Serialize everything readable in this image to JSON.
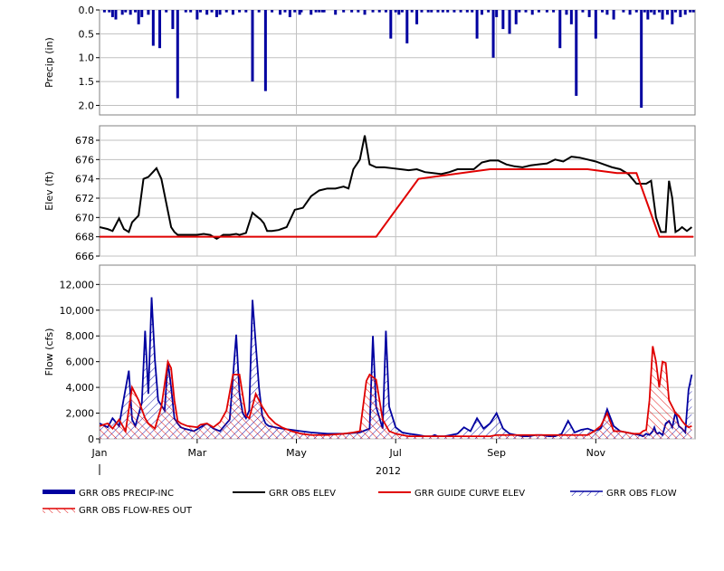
{
  "chart_data": [
    {
      "type": "bar",
      "panel": "precip",
      "ylabel": "Precip (in)",
      "ylim": [
        2.2,
        0.0
      ],
      "y_inverted": true,
      "yticks": [
        0.0,
        0.5,
        1.0,
        1.5,
        2.0
      ],
      "ytick_labels": [
        "0.0",
        "0.5",
        "1.0",
        "1.5",
        "2.0"
      ],
      "grid": true,
      "series": [
        {
          "name": "GRR OBS PRECIP-INC",
          "color": "#0000a0",
          "x": [
            3,
            6,
            8,
            10,
            14,
            16,
            19,
            22,
            24,
            26,
            30,
            33,
            37,
            41,
            45,
            48,
            53,
            56,
            60,
            62,
            66,
            69,
            72,
            74,
            78,
            82,
            86,
            90,
            94,
            98,
            102,
            106,
            111,
            114,
            117,
            120,
            123,
            124,
            130,
            133,
            135,
            137,
            138,
            145,
            150,
            155,
            159,
            163,
            168,
            172,
            176,
            179,
            182,
            184,
            186,
            189,
            192,
            195,
            198,
            202,
            204,
            208,
            211,
            214,
            218,
            222,
            226,
            229,
            232,
            235,
            239,
            242,
            244,
            248,
            252,
            256,
            258,
            262,
            266,
            270,
            275,
            279,
            283,
            287,
            290,
            293,
            297,
            301,
            305,
            309,
            312,
            316,
            322,
            326,
            330,
            333,
            335,
            337,
            339,
            341,
            344,
            346,
            349,
            352,
            354,
            357,
            360,
            363,
            365
          ],
          "values": [
            0.05,
            0.05,
            0.15,
            0.2,
            0.1,
            0.05,
            0.1,
            0.05,
            0.3,
            0.15,
            0.1,
            0.75,
            0.8,
            0.05,
            0.4,
            1.85,
            0.05,
            0.05,
            0.2,
            0.05,
            0.1,
            0.05,
            0.15,
            0.1,
            0.05,
            0.1,
            0.05,
            0.05,
            1.5,
            0.05,
            1.7,
            0.05,
            0.1,
            0.05,
            0.15,
            0.05,
            0.1,
            0.05,
            0.1,
            0.05,
            0.05,
            0.05,
            0.05,
            0.1,
            0.05,
            0.05,
            0.05,
            0.1,
            0.05,
            0.05,
            0.05,
            0.6,
            0.05,
            0.1,
            0.05,
            0.7,
            0.05,
            0.3,
            0.05,
            0.05,
            0.05,
            0.05,
            0.05,
            0.05,
            0.05,
            0.05,
            0.05,
            0.05,
            0.6,
            0.1,
            0.05,
            1.0,
            0.15,
            0.4,
            0.5,
            0.3,
            0.05,
            0.05,
            0.1,
            0.05,
            0.05,
            0.05,
            0.8,
            0.1,
            0.3,
            1.8,
            0.05,
            0.15,
            0.6,
            0.05,
            0.1,
            0.2,
            0.05,
            0.1,
            0.05,
            2.05,
            0.05,
            0.2,
            0.05,
            0.1,
            0.05,
            0.2,
            0.1,
            0.3,
            0.05,
            0.15,
            0.1,
            0.05,
            0.05
          ]
        }
      ]
    },
    {
      "type": "line",
      "panel": "elev",
      "ylabel": "Elev (ft)",
      "ylim": [
        666,
        679.5
      ],
      "yticks": [
        666,
        668,
        670,
        672,
        674,
        676,
        678
      ],
      "ytick_labels": [
        "666",
        "668",
        "670",
        "672",
        "674",
        "676",
        "678"
      ],
      "grid": true,
      "series": [
        {
          "name": "GRR OBS ELEV",
          "color": "#000000",
          "x": [
            0,
            5,
            8,
            12,
            15,
            18,
            20,
            24,
            27,
            30,
            35,
            38,
            41,
            44,
            46,
            48,
            50,
            53,
            56,
            60,
            64,
            68,
            72,
            76,
            80,
            84,
            86,
            90,
            94,
            96,
            99,
            101,
            103,
            106,
            110,
            115,
            120,
            125,
            130,
            135,
            140,
            145,
            150,
            153,
            156,
            160,
            163,
            166,
            170,
            175,
            180,
            185,
            190,
            195,
            200,
            205,
            210,
            215,
            220,
            225,
            230,
            235,
            240,
            245,
            250,
            255,
            260,
            265,
            270,
            275,
            280,
            285,
            290,
            295,
            300,
            305,
            310,
            315,
            320,
            325,
            330,
            334,
            336,
            339,
            342,
            345,
            348,
            350,
            352,
            354,
            356,
            358,
            361,
            364
          ],
          "values": [
            669.0,
            668.8,
            668.6,
            669.9,
            668.8,
            668.5,
            669.5,
            670.2,
            674.0,
            674.2,
            675.1,
            674.0,
            671.5,
            669.0,
            668.5,
            668.2,
            668.2,
            668.2,
            668.2,
            668.2,
            668.3,
            668.2,
            667.8,
            668.2,
            668.2,
            668.3,
            668.2,
            668.4,
            670.5,
            670.2,
            669.8,
            669.4,
            668.6,
            668.6,
            668.7,
            669.0,
            670.8,
            671.0,
            672.2,
            672.8,
            673.0,
            673.0,
            673.2,
            673.0,
            675.0,
            676.0,
            678.5,
            675.5,
            675.2,
            675.2,
            675.1,
            675.0,
            674.9,
            675.0,
            674.7,
            674.6,
            674.5,
            674.7,
            675.0,
            675.0,
            675.0,
            675.7,
            675.9,
            675.9,
            675.5,
            675.3,
            675.2,
            675.4,
            675.5,
            675.6,
            676.0,
            675.8,
            676.3,
            676.2,
            676.0,
            675.8,
            675.5,
            675.2,
            675.0,
            674.5,
            673.5,
            673.5,
            673.5,
            673.8,
            670.0,
            668.5,
            668.5,
            673.8,
            672.0,
            668.5,
            668.7,
            669.0,
            668.6,
            669.0
          ]
        },
        {
          "name": "GRR GUIDE CURVE ELEV",
          "color": "#e00000",
          "x": [
            0,
            74,
            90,
            110,
            130,
            150,
            170,
            196,
            240,
            280,
            300,
            318,
            330,
            344,
            365
          ],
          "values": [
            668.0,
            668.0,
            668.0,
            668.0,
            668.0,
            668.0,
            668.0,
            674.0,
            675.0,
            675.0,
            675.0,
            674.6,
            674.6,
            668.0,
            668.0
          ]
        }
      ]
    },
    {
      "type": "area",
      "panel": "flow",
      "ylabel": "Flow (cfs)",
      "ylim": [
        0,
        13500
      ],
      "yticks": [
        0,
        2000,
        4000,
        6000,
        8000,
        10000,
        12000
      ],
      "ytick_labels": [
        "0",
        "2,000",
        "4,000",
        "6,000",
        "8,000",
        "10,000",
        "12,000"
      ],
      "xticks": [
        0,
        60,
        121,
        182,
        244,
        305
      ],
      "xtick_labels": [
        "Jan",
        "Mar",
        "May",
        "Jul",
        "Sep",
        "Nov"
      ],
      "xlabel": "2012",
      "grid": true,
      "series": [
        {
          "name": "GRR OBS FLOW",
          "color": "#0000a0",
          "x": [
            0,
            5,
            8,
            12,
            14,
            18,
            20,
            22,
            26,
            28,
            30,
            32,
            34,
            36,
            38,
            40,
            42,
            44,
            46,
            48,
            50,
            52,
            55,
            58,
            62,
            66,
            70,
            74,
            80,
            84,
            86,
            88,
            90,
            92,
            94,
            98,
            100,
            102,
            104,
            108,
            112,
            118,
            124,
            130,
            140,
            150,
            160,
            166,
            168,
            170,
            174,
            176,
            178,
            182,
            186,
            190,
            196,
            200,
            204,
            206,
            208,
            212,
            216,
            220,
            224,
            228,
            232,
            236,
            240,
            244,
            248,
            252,
            256,
            260,
            264,
            268,
            272,
            276,
            280,
            284,
            288,
            292,
            296,
            300,
            304,
            308,
            312,
            316,
            320,
            324,
            328,
            332,
            334,
            336,
            338,
            340,
            341,
            342,
            343,
            344,
            346,
            348,
            350,
            352,
            354,
            356,
            358,
            360,
            362,
            364
          ],
          "values": [
            1200,
            900,
            1600,
            1000,
            2500,
            5300,
            1500,
            1000,
            2800,
            8400,
            3500,
            11000,
            6200,
            3000,
            2600,
            2200,
            6000,
            4000,
            1600,
            1200,
            900,
            800,
            700,
            600,
            900,
            1200,
            800,
            600,
            1500,
            8100,
            3500,
            2000,
            1600,
            2200,
            10800,
            4000,
            1800,
            1200,
            1000,
            900,
            800,
            700,
            600,
            500,
            400,
            400,
            500,
            800,
            8000,
            2500,
            800,
            8400,
            2500,
            900,
            500,
            400,
            300,
            200,
            200,
            300,
            200,
            200,
            300,
            400,
            900,
            600,
            1600,
            800,
            1200,
            2000,
            800,
            400,
            300,
            200,
            200,
            300,
            300,
            200,
            200,
            400,
            1400,
            500,
            700,
            800,
            600,
            800,
            2300,
            1000,
            600,
            500,
            400,
            300,
            200,
            400,
            300,
            600,
            900,
            500,
            400,
            500,
            300,
            1200,
            1400,
            900,
            2100,
            1000,
            800,
            500,
            3800,
            5000
          ]
        },
        {
          "name": "GRR OBS FLOW-RES OUT",
          "color": "#e00000",
          "x": [
            0,
            5,
            8,
            12,
            16,
            20,
            24,
            28,
            30,
            34,
            38,
            42,
            44,
            46,
            48,
            50,
            54,
            60,
            62,
            66,
            70,
            74,
            78,
            82,
            86,
            90,
            92,
            96,
            100,
            104,
            108,
            112,
            118,
            124,
            130,
            140,
            150,
            156,
            160,
            164,
            166,
            170,
            174,
            178,
            182,
            186,
            190,
            196,
            200,
            206,
            212,
            218,
            224,
            230,
            236,
            240,
            244,
            248,
            252,
            256,
            260,
            264,
            268,
            272,
            276,
            280,
            284,
            288,
            292,
            296,
            300,
            304,
            308,
            312,
            316,
            320,
            324,
            328,
            332,
            334,
            336,
            338,
            340,
            342,
            344,
            346,
            348,
            350,
            352,
            354,
            356,
            358,
            360,
            362,
            364
          ],
          "values": [
            1000,
            1200,
            800,
            1500,
            600,
            4000,
            3000,
            1600,
            1200,
            800,
            2500,
            6000,
            5500,
            3000,
            1400,
            1200,
            1000,
            900,
            1100,
            1200,
            900,
            1300,
            2200,
            5000,
            5000,
            1800,
            1600,
            3500,
            2500,
            1700,
            1200,
            900,
            600,
            400,
            300,
            300,
            400,
            500,
            600,
            4500,
            5000,
            4600,
            1500,
            600,
            400,
            300,
            200,
            200,
            200,
            200,
            200,
            200,
            200,
            200,
            200,
            200,
            300,
            300,
            300,
            300,
            300,
            300,
            300,
            300,
            300,
            300,
            300,
            300,
            300,
            300,
            300,
            600,
            1000,
            2000,
            600,
            600,
            500,
            400,
            400,
            600,
            700,
            3000,
            7200,
            6000,
            4000,
            6000,
            5900,
            3000,
            2500,
            2000,
            1800,
            1400,
            1100,
            900,
            1000
          ]
        }
      ]
    }
  ],
  "legend": {
    "items": [
      {
        "label": "GRR OBS PRECIP-INC",
        "style": "thick-bar",
        "color": "#0000a0"
      },
      {
        "label": "GRR OBS ELEV",
        "style": "line",
        "color": "#000000"
      },
      {
        "label": "GRR GUIDE CURVE ELEV",
        "style": "line",
        "color": "#e00000"
      },
      {
        "label": "GRR OBS FLOW",
        "style": "hatch-blue",
        "color": "#0000a0"
      },
      {
        "label": "GRR OBS FLOW-RES OUT",
        "style": "hatch-red",
        "color": "#e00000"
      }
    ]
  }
}
